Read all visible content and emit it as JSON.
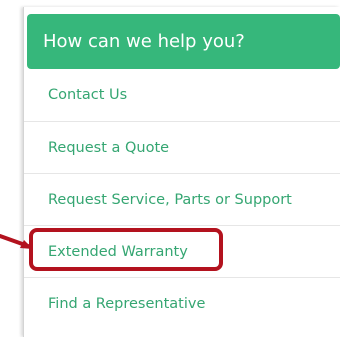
{
  "menu": {
    "title": "How can we help you?",
    "items": [
      {
        "label": "Contact Us"
      },
      {
        "label": "Request a Quote"
      },
      {
        "label": "Request Service, Parts or Support"
      },
      {
        "label": "Extended Warranty"
      },
      {
        "label": "Find a Representative"
      }
    ]
  },
  "colors": {
    "header_background": "#36b77b",
    "header_text": "#ffffff",
    "link_text": "#35a672",
    "annotation": "#b3121e"
  }
}
